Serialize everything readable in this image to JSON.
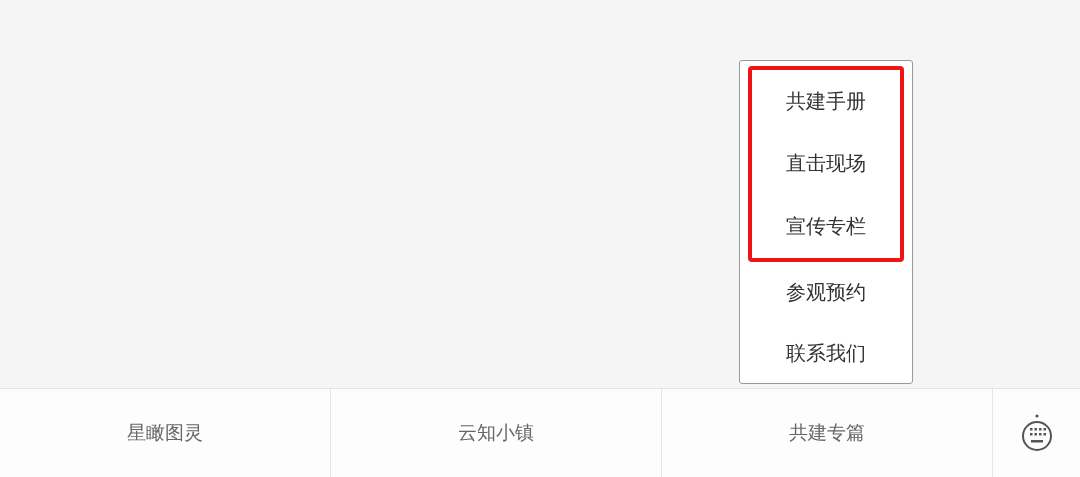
{
  "popup_menu": {
    "items": [
      {
        "label": "共建手册",
        "highlighted": true
      },
      {
        "label": "直击现场",
        "highlighted": true
      },
      {
        "label": "宣传专栏",
        "highlighted": true
      },
      {
        "label": "参观预约",
        "highlighted": false
      },
      {
        "label": "联系我们",
        "highlighted": false
      }
    ]
  },
  "bottom_menu": {
    "tabs": [
      {
        "label": "星瞰图灵"
      },
      {
        "label": "云知小镇"
      },
      {
        "label": "共建专篇"
      }
    ]
  }
}
